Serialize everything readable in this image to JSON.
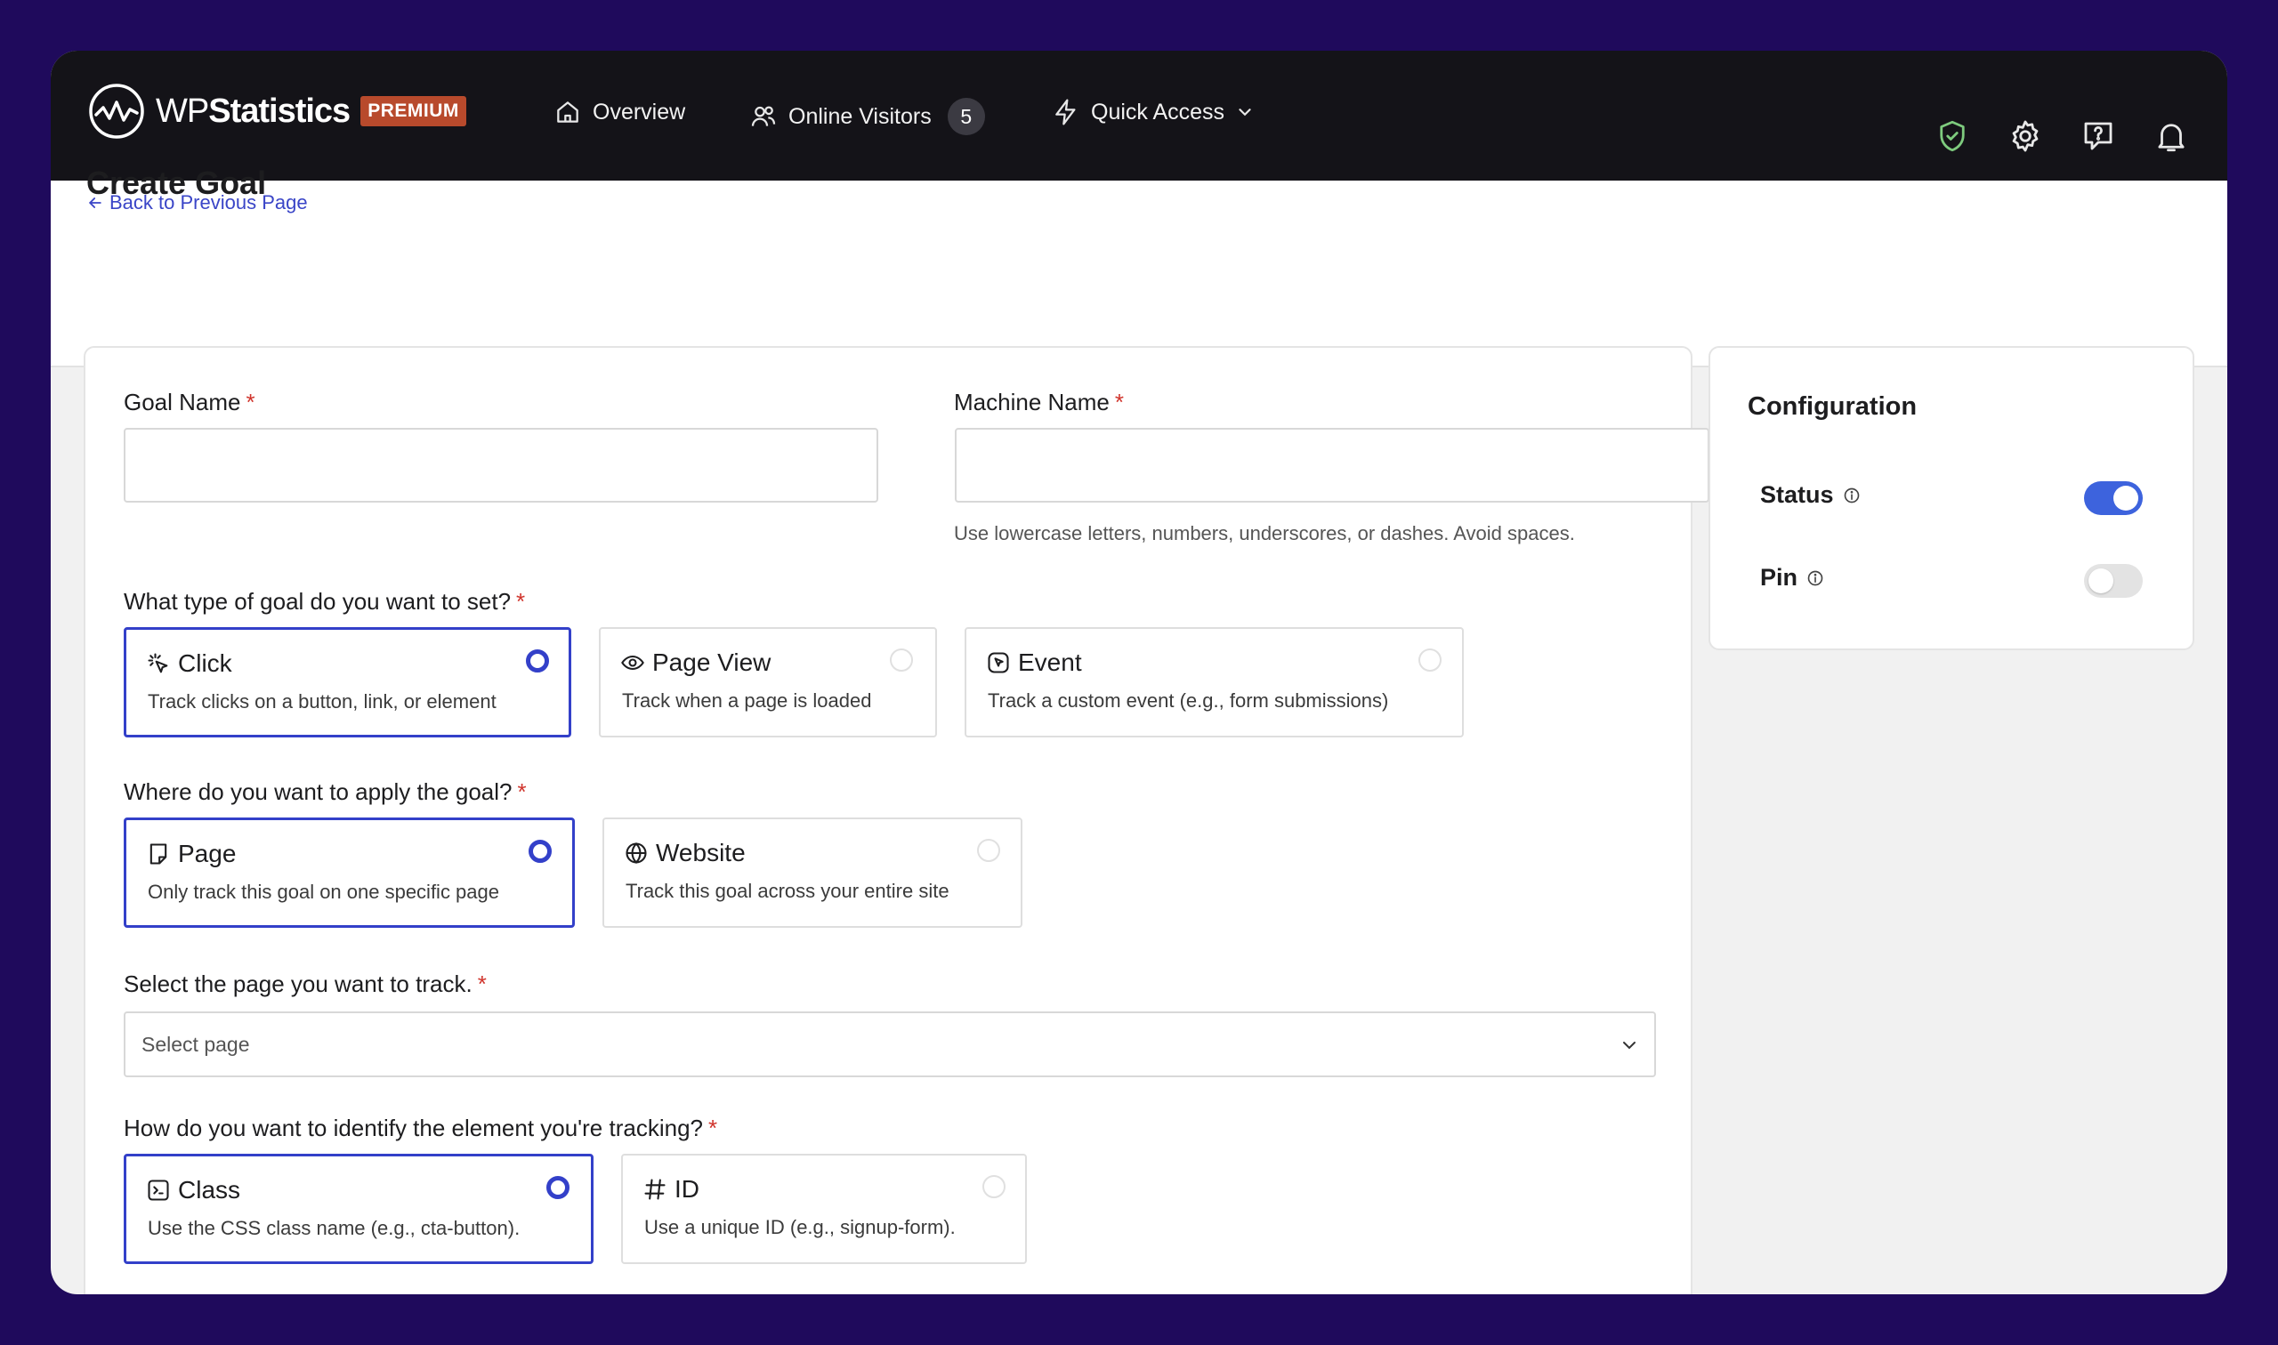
{
  "brand": {
    "name_light": "WP",
    "name_bold": "Statistics",
    "badge": "PREMIUM"
  },
  "nav": {
    "overview": "Overview",
    "online_visitors": "Online Visitors",
    "online_count": "5",
    "quick_access": "Quick Access"
  },
  "header": {
    "back_link": "Back to Previous Page",
    "title": "Create Goal"
  },
  "form": {
    "goal_name": {
      "label": "Goal Name",
      "required": "*",
      "value": ""
    },
    "machine_name": {
      "label": "Machine Name",
      "required": "*",
      "value": "",
      "helper": "Use lowercase letters, numbers, underscores, or dashes. Avoid spaces."
    },
    "goal_type": {
      "question": "What type of goal do you want to set?",
      "required": "*",
      "options": [
        {
          "title": "Click",
          "desc": "Track clicks on a button, link, or element",
          "icon": "click-icon",
          "selected": true
        },
        {
          "title": "Page View",
          "desc": "Track when a page is loaded",
          "icon": "eye-icon",
          "selected": false
        },
        {
          "title": "Event",
          "desc": "Track a custom event (e.g., form submissions)",
          "icon": "event-icon",
          "selected": false
        }
      ]
    },
    "apply_scope": {
      "question": "Where do you want to apply the goal?",
      "required": "*",
      "options": [
        {
          "title": "Page",
          "desc": "Only track this goal on one specific page",
          "icon": "page-icon",
          "selected": true
        },
        {
          "title": "Website",
          "desc": "Track this goal across your entire site",
          "icon": "globe-icon",
          "selected": false
        }
      ]
    },
    "page_select": {
      "question": "Select the page you want to track.",
      "required": "*",
      "placeholder": "Select page"
    },
    "element_identify": {
      "question": "How do you want to identify the element you're tracking?",
      "required": "*",
      "options": [
        {
          "title": "Class",
          "desc": "Use the CSS class name (e.g., cta-button).",
          "icon": "class-icon",
          "selected": true
        },
        {
          "title": "ID",
          "desc": "Use a unique ID (e.g., signup-form).",
          "icon": "hash-icon",
          "selected": false
        }
      ]
    }
  },
  "configuration": {
    "title": "Configuration",
    "status": {
      "label": "Status",
      "on": true
    },
    "pin": {
      "label": "Pin",
      "on": false
    }
  },
  "colors": {
    "accent": "#3340c9",
    "toggle_on": "#3d63dd",
    "topbar": "#141318",
    "backdrop": "#1f0a5c",
    "premium_badge": "#b84a2c",
    "required": "#d0342c"
  }
}
